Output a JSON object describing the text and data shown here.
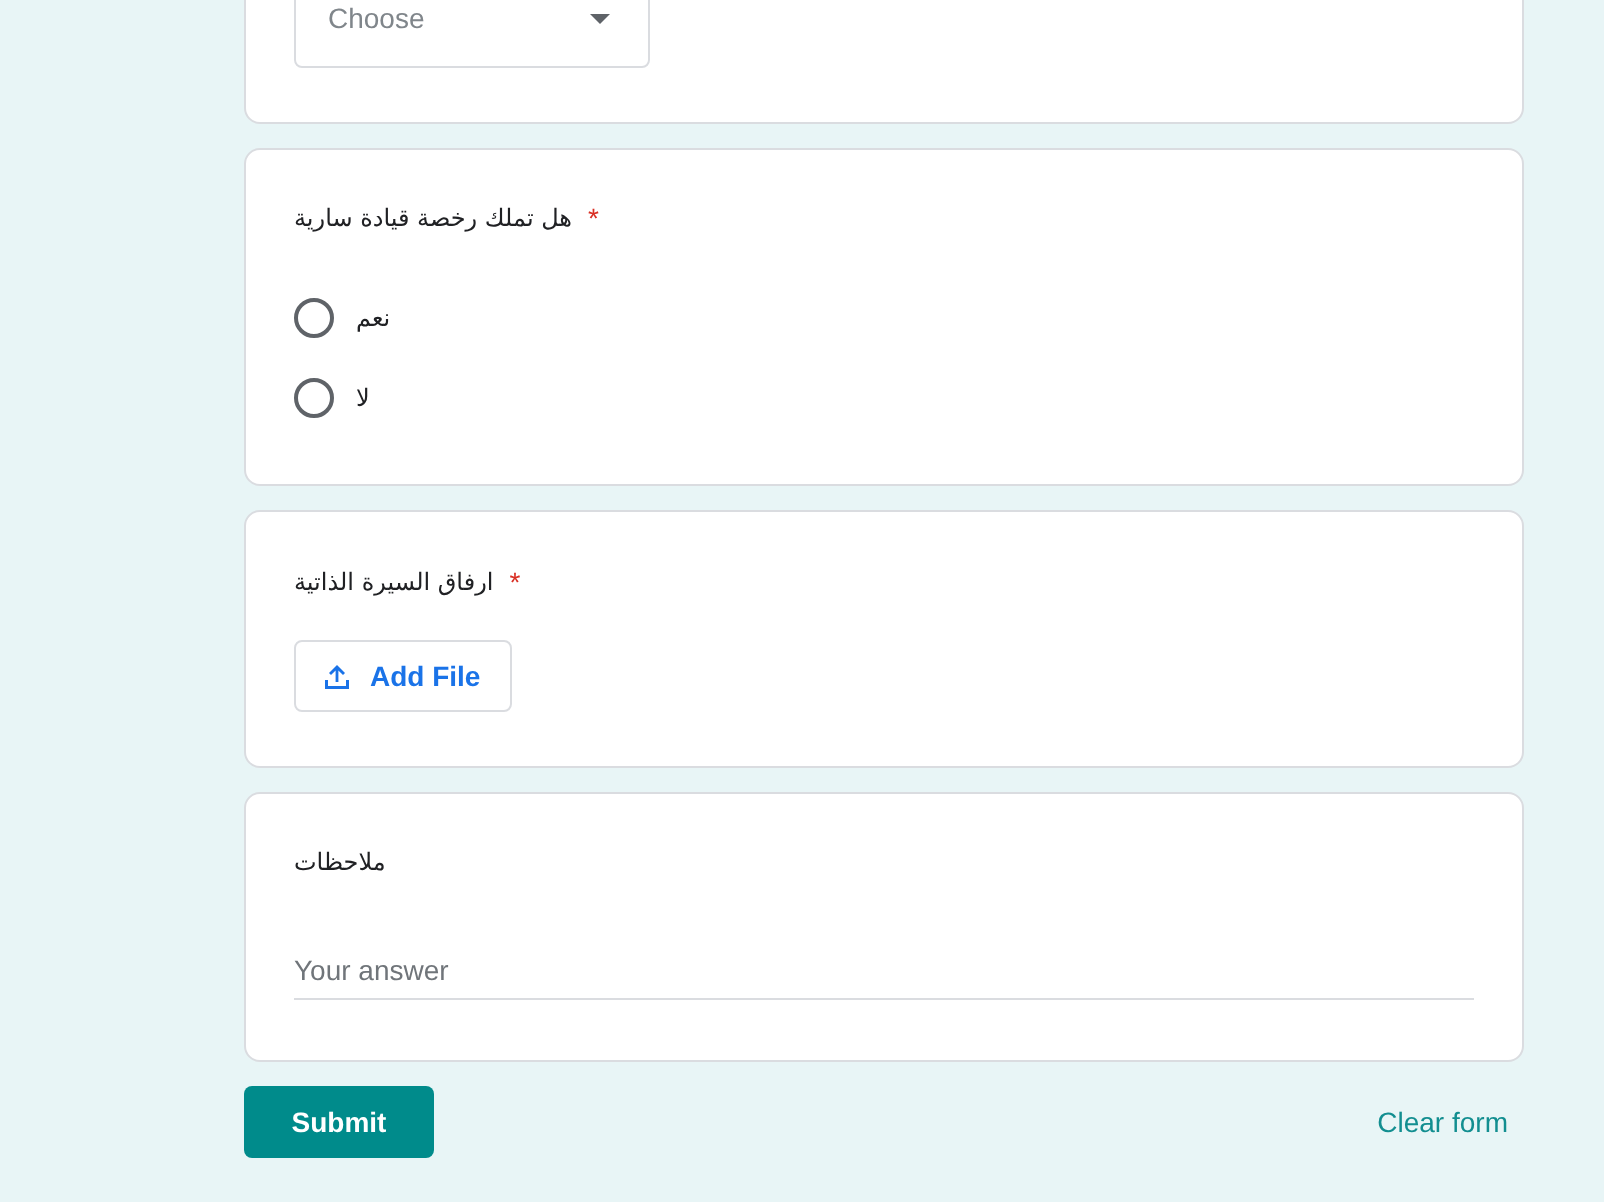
{
  "questions": [
    {
      "kind": "dropdown",
      "placeholder": "Choose"
    },
    {
      "kind": "radio",
      "title": "هل تملك رخصة قيادة سارية",
      "required_mark": "*",
      "options": [
        {
          "label": "نعم",
          "selected": false
        },
        {
          "label": "لا",
          "selected": false
        }
      ]
    },
    {
      "kind": "file",
      "title": "ارفاق السيرة الذاتية",
      "required_mark": "*",
      "button": "Add File"
    },
    {
      "kind": "text",
      "title": "ملاحظات",
      "placeholder": "Your answer"
    }
  ],
  "actions": {
    "submit": "Submit",
    "clear": "Clear form"
  }
}
